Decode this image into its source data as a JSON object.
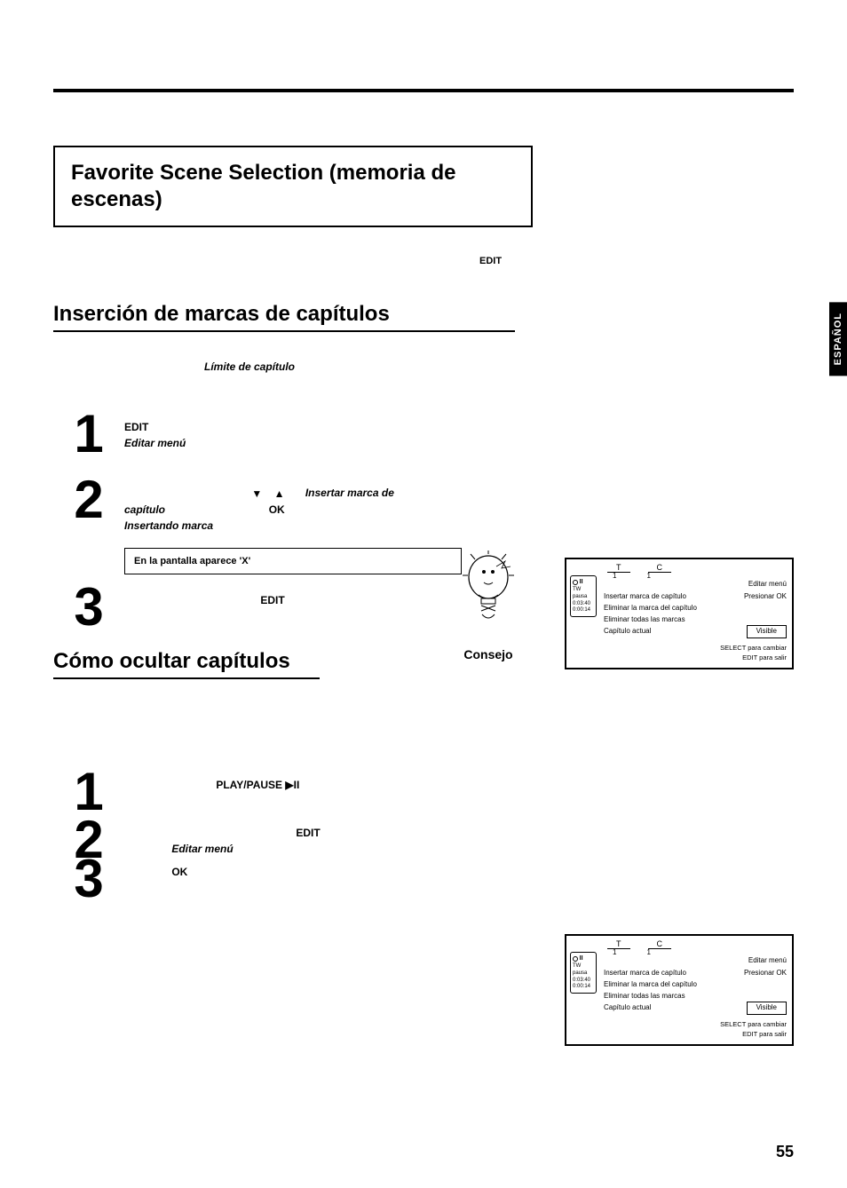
{
  "tab": "ESPAÑOL",
  "title": "Favorite Scene Selection (memoria de escenas)",
  "intro_edit": "EDIT",
  "sec1_title": "Inserción de marcas de capítulos",
  "limit_label": "Límite de capítulo",
  "step1": {
    "num": "1",
    "edit": "EDIT",
    "menu": "Editar menú"
  },
  "step2": {
    "num": "2",
    "insertar": "Insertar marca de",
    "capitulo": "capítulo",
    "ok": "OK",
    "insertando": "Insertando marca"
  },
  "note": "En la pantalla aparece 'X'",
  "consejo": "Consejo",
  "step3": {
    "num": "3",
    "edit": "EDIT"
  },
  "sec2_title": "Cómo ocultar capítulos",
  "hide": {
    "s1": {
      "num": "1",
      "pp": "PLAY/PAUSE",
      "sym": "▶II"
    },
    "s2": {
      "num": "2",
      "edit": "EDIT",
      "menu": "Editar menú"
    },
    "s3": {
      "num": "3",
      "ok": "OK"
    }
  },
  "osd": {
    "T": "T",
    "C": "C",
    "t1": "1",
    "c1": "1",
    "left_pause": "II",
    "left_tw": "TW pausa",
    "left_time1": "0:03:40",
    "left_time2": "0:00:14",
    "title_right": "Editar menú",
    "r1": "Insertar marca de capítulo",
    "r1r": "Presionar OK",
    "r2": "Eliminar la marca del capítulo",
    "r3": "Eliminar todas las marcas",
    "r4": "Capítulo actual",
    "vis": "Visible",
    "f1": "SELECT para cambiar",
    "f2": "EDIT para salir"
  },
  "page_num": "55"
}
